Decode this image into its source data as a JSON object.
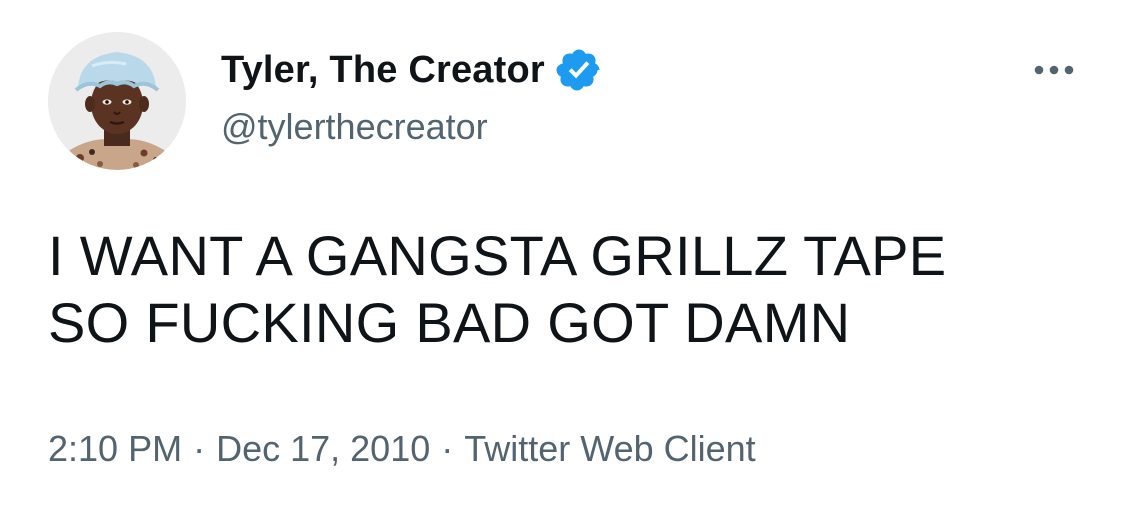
{
  "tweet": {
    "author": {
      "display_name": "Tyler, The Creator",
      "handle": "@tylerthecreator",
      "verified": true,
      "verified_color": "#1d9bf0",
      "avatar_icon": "profile-photo"
    },
    "more_icon": "more-horizontal-icon",
    "text_lines": [
      "I WANT A GANGSTA GRILLZ TAPE",
      "SO FUCKING BAD GOT DAMN"
    ],
    "meta": {
      "time": "2:10 PM",
      "separator": "·",
      "date": "Dec 17, 2010",
      "source": "Twitter Web Client"
    }
  },
  "colors": {
    "text": "#0f1419",
    "secondary_text": "#536471",
    "background": "#ffffff",
    "verified": "#1d9bf0"
  }
}
